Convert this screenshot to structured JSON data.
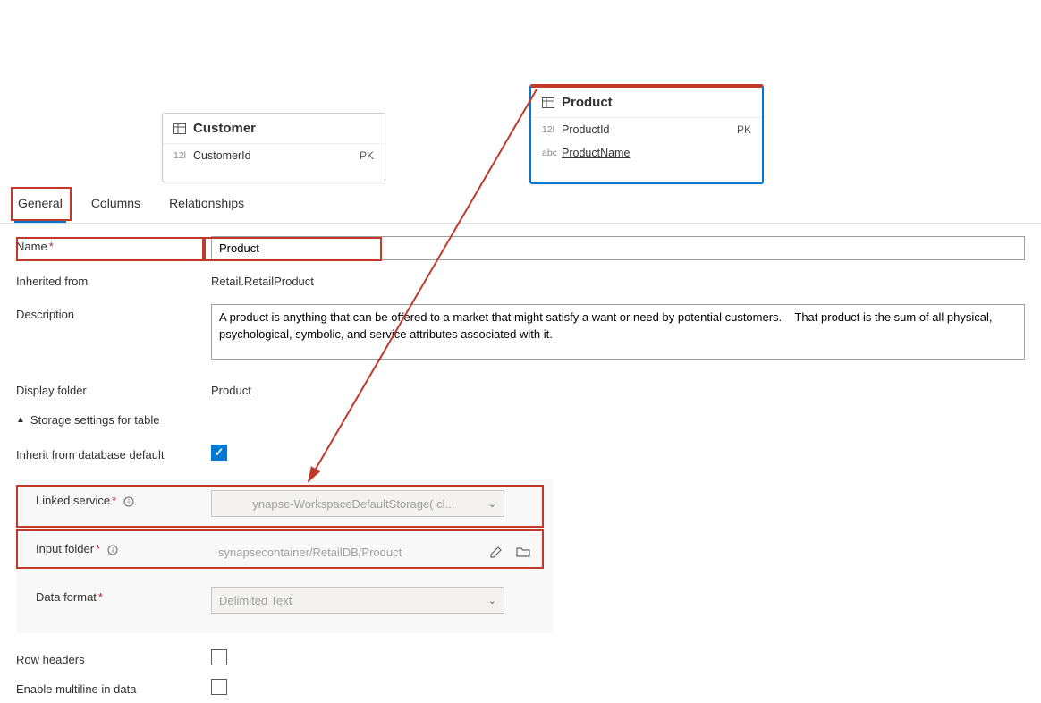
{
  "canvas": {
    "customer": {
      "title": "Customer",
      "row1_type": "12l",
      "row1_name": "CustomerId",
      "row1_pk": "PK"
    },
    "product": {
      "title": "Product",
      "row1_type": "12l",
      "row1_name": "ProductId",
      "row1_pk": "PK",
      "row2_type": "abc",
      "row2_name": "ProductName"
    }
  },
  "tabs": {
    "general": "General",
    "columns": "Columns",
    "relationships": "Relationships"
  },
  "form": {
    "name_label": "Name",
    "name_value": "Product",
    "inherited_label": "Inherited from",
    "inherited_value": "Retail.RetailProduct",
    "description_label": "Description",
    "description_value": "A product is anything that can be offered to a market that might satisfy a want or need by potential customers.    That product is the sum of all physical, psychological, symbolic, and service attributes associated with it.",
    "displayfolder_label": "Display folder",
    "displayfolder_value": "Product",
    "storage_header": "Storage settings for table",
    "inherit_default_label": "Inherit from database default",
    "linked_service_label": "Linked service",
    "linked_service_value": "ynapse-WorkspaceDefaultStorage(         cl...",
    "input_folder_label": "Input folder",
    "input_folder_value": "synapsecontainer/RetailDB/Product",
    "data_format_label": "Data format",
    "data_format_value": "Delimited Text",
    "row_headers_label": "Row headers",
    "multiline_label": "Enable multiline in data"
  }
}
